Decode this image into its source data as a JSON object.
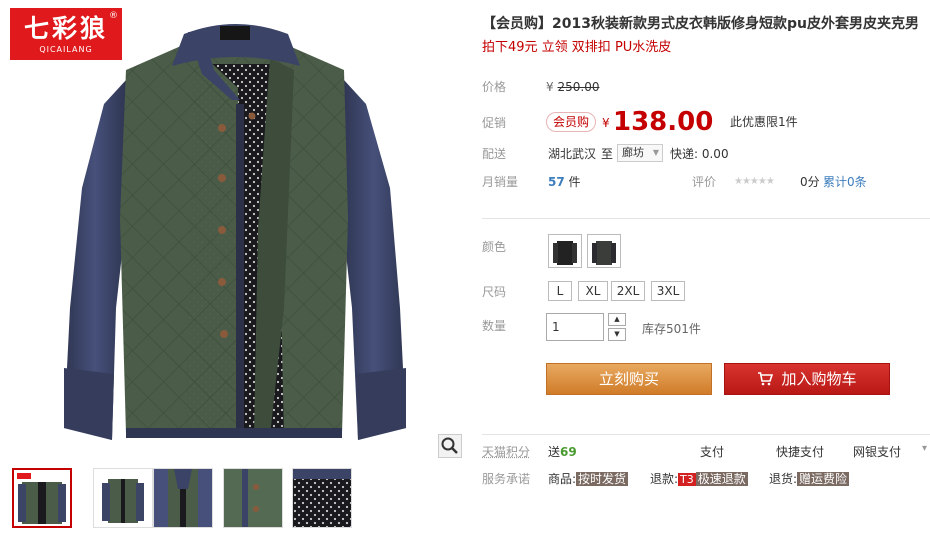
{
  "brand_logo": {
    "cn": "七彩狼",
    "en": "QICAILANG",
    "reg": "®"
  },
  "product": {
    "title": "【会员购】2013秋装新款男式皮衣韩版修身短款pu皮外套男皮夹克男",
    "subtitle": "拍下49元 立领 双排扣 PU水洗皮"
  },
  "price": {
    "label": "价格",
    "currency": "¥",
    "original": "250.00",
    "promo_label": "促销",
    "vip_badge": "会员购",
    "promo_price": "138.00",
    "promo_note": "此优惠限1件"
  },
  "shipping": {
    "label": "配送",
    "from": "湖北武汉",
    "to_label": "至",
    "to_city": "廊坊",
    "fee": "快递: 0.00"
  },
  "sales": {
    "label": "月销量",
    "count": "57",
    "unit": "件",
    "review_label": "评价",
    "stars": "★★★★★",
    "score": "0分",
    "review_count": "累计0条"
  },
  "options": {
    "color_label": "颜色",
    "size_label": "尺码",
    "sizes": [
      "L",
      "XL",
      "2XL",
      "3XL"
    ],
    "qty_label": "数量",
    "qty_value": "1",
    "stock": "库存501件"
  },
  "actions": {
    "buy_now": "立刻购买",
    "add_cart": "加入购物车"
  },
  "points": {
    "label": "天猫积分",
    "prefix": "送",
    "value": "69"
  },
  "payments": [
    "支付",
    "快捷支付",
    "网银支付"
  ],
  "service": {
    "label": "服务承诺",
    "goods_prefix": "商品:",
    "goods": "按时发货",
    "refund_prefix": "退款:",
    "refund_tag": "T3",
    "refund": "极速退款",
    "return_prefix": "退货:",
    "return": "赠运费险"
  },
  "colors": {
    "accent": "#c40000",
    "buy_button": "#d8893e",
    "cart_button": "#c8201c",
    "jacket_body": "#4b5d49",
    "jacket_sleeve": "#3c4566"
  },
  "icons": [
    "zoom-icon",
    "cart-icon",
    "star-icon",
    "chevron-down-icon",
    "arrow-up-icon",
    "arrow-down-icon"
  ]
}
